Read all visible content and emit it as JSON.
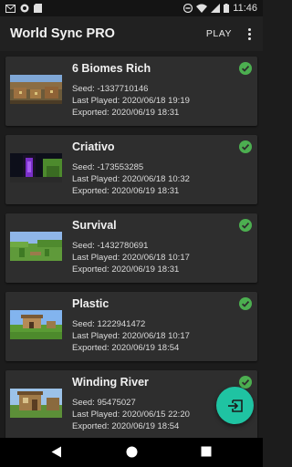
{
  "status_bar": {
    "time": "11:46",
    "icons_left": [
      "gmail-icon",
      "sync-icon",
      "sdcard-icon"
    ],
    "icons_right": [
      "dnd-icon",
      "wifi-icon",
      "signal-icon",
      "battery-icon"
    ]
  },
  "app_bar": {
    "title": "World Sync PRO",
    "play_label": "PLAY",
    "overflow_icon": "more-vert-icon"
  },
  "labels": {
    "seed": "Seed: ",
    "last_played": "Last Played: ",
    "exported": "Exported: "
  },
  "worlds": [
    {
      "name": "6 Biomes Rich",
      "seed": "-1337710146",
      "last_played": "2020/06/18 19:19",
      "exported": "2020/06/19 18:31",
      "synced": true,
      "thumb": "chests"
    },
    {
      "name": "Criativo",
      "seed": "-173553285",
      "last_played": "2020/06/18 10:32",
      "exported": "2020/06/19 18:31",
      "synced": true,
      "thumb": "portal"
    },
    {
      "name": "Survival",
      "seed": "-1432780691",
      "last_played": "2020/06/18 10:17",
      "exported": "2020/06/19 18:31",
      "synced": true,
      "thumb": "plains"
    },
    {
      "name": "Plastic",
      "seed": "1222941472",
      "last_played": "2020/06/18 10:17",
      "exported": "2020/06/19 18:54",
      "synced": true,
      "thumb": "village"
    },
    {
      "name": "Winding River",
      "seed": "95475027",
      "last_played": "2020/06/15 22:20",
      "exported": "2020/06/19 18:54",
      "synced": true,
      "thumb": "house"
    }
  ],
  "fab": {
    "icon": "import-icon",
    "color": "#1fc3a2"
  },
  "colors": {
    "check": "#4caf50",
    "card": "#2e2e2e",
    "background": "#1c1c1c"
  },
  "nav_bar": {
    "icons": [
      "back-icon",
      "home-icon",
      "recents-icon"
    ]
  }
}
